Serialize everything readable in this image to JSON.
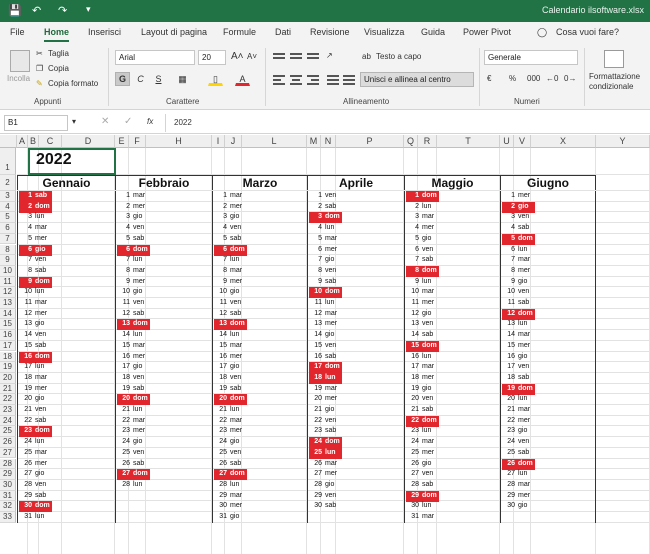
{
  "window": {
    "title": "Calendario ilsoftware.xlsx"
  },
  "tabs": [
    "File",
    "Home",
    "Inserisci",
    "Layout di pagina",
    "Formule",
    "Dati",
    "Revisione",
    "Visualizza",
    "Guida",
    "Power Pivot"
  ],
  "active_tab": "Home",
  "tell_me": "Cosa vuoi fare?",
  "clipboard": {
    "paste": "Incolla",
    "cut": "Taglia",
    "copy": "Copia",
    "format_painter": "Copia formato",
    "group": "Appunti"
  },
  "font": {
    "name": "Arial",
    "size": "20",
    "bold": "G",
    "italic": "C",
    "underline": "S",
    "group": "Carattere"
  },
  "alignment": {
    "wrap": "Testo a capo",
    "merge": "Unisci e allinea al centro",
    "group": "Allineamento"
  },
  "number": {
    "format": "Generale",
    "group": "Numeri",
    "percent": "%",
    "thousands": "000"
  },
  "styles": {
    "conditional": "Formattazione condizionale"
  },
  "formula_bar": {
    "name_box": "B1",
    "value": "2022",
    "fx": "fx"
  },
  "columns": [
    "A",
    "B",
    "C",
    "D",
    "E",
    "F",
    "G",
    "H",
    "I",
    "J",
    "K",
    "L",
    "M",
    "N",
    "O",
    "P",
    "Q",
    "R",
    "S",
    "T",
    "U",
    "V",
    "W",
    "X",
    "Y"
  ],
  "rows": [
    "1",
    "2",
    "3",
    "4",
    "5",
    "6",
    "7",
    "8",
    "9",
    "10",
    "11",
    "12",
    "13",
    "14",
    "15",
    "16",
    "17",
    "18",
    "19",
    "20",
    "21",
    "22",
    "23",
    "24",
    "25",
    "26",
    "27",
    "28",
    "29",
    "30",
    "31",
    "32",
    "33"
  ],
  "year": "2022",
  "holiday_color": "#e1262d",
  "months": [
    {
      "name": "Gennaio",
      "days": [
        [
          "1",
          "sab",
          1
        ],
        [
          "2",
          "dom",
          1
        ],
        [
          "3",
          "lun",
          0
        ],
        [
          "4",
          "mar",
          0
        ],
        [
          "5",
          "mer",
          0
        ],
        [
          "6",
          "gio",
          1
        ],
        [
          "7",
          "ven",
          0
        ],
        [
          "8",
          "sab",
          0
        ],
        [
          "9",
          "dom",
          1
        ],
        [
          "10",
          "lun",
          0
        ],
        [
          "11",
          "mar",
          0
        ],
        [
          "12",
          "mer",
          0
        ],
        [
          "13",
          "gio",
          0
        ],
        [
          "14",
          "ven",
          0
        ],
        [
          "15",
          "sab",
          0
        ],
        [
          "16",
          "dom",
          1
        ],
        [
          "17",
          "lun",
          0
        ],
        [
          "18",
          "mar",
          0
        ],
        [
          "19",
          "mer",
          0
        ],
        [
          "20",
          "gio",
          0
        ],
        [
          "21",
          "ven",
          0
        ],
        [
          "22",
          "sab",
          0
        ],
        [
          "23",
          "dom",
          1
        ],
        [
          "24",
          "lun",
          0
        ],
        [
          "25",
          "mar",
          0
        ],
        [
          "26",
          "mer",
          0
        ],
        [
          "27",
          "gio",
          0
        ],
        [
          "28",
          "ven",
          0
        ],
        [
          "29",
          "sab",
          0
        ],
        [
          "30",
          "dom",
          1
        ],
        [
          "31",
          "lun",
          0
        ]
      ]
    },
    {
      "name": "Febbraio",
      "days": [
        [
          "1",
          "mar",
          0
        ],
        [
          "2",
          "mer",
          0
        ],
        [
          "3",
          "gio",
          0
        ],
        [
          "4",
          "ven",
          0
        ],
        [
          "5",
          "sab",
          0
        ],
        [
          "6",
          "dom",
          1
        ],
        [
          "7",
          "lun",
          0
        ],
        [
          "8",
          "mar",
          0
        ],
        [
          "9",
          "mer",
          0
        ],
        [
          "10",
          "gio",
          0
        ],
        [
          "11",
          "ven",
          0
        ],
        [
          "12",
          "sab",
          0
        ],
        [
          "13",
          "dom",
          1
        ],
        [
          "14",
          "lun",
          0
        ],
        [
          "15",
          "mar",
          0
        ],
        [
          "16",
          "mer",
          0
        ],
        [
          "17",
          "gio",
          0
        ],
        [
          "18",
          "ven",
          0
        ],
        [
          "19",
          "sab",
          0
        ],
        [
          "20",
          "dom",
          1
        ],
        [
          "21",
          "lun",
          0
        ],
        [
          "22",
          "mar",
          0
        ],
        [
          "23",
          "mer",
          0
        ],
        [
          "24",
          "gio",
          0
        ],
        [
          "25",
          "ven",
          0
        ],
        [
          "26",
          "sab",
          0
        ],
        [
          "27",
          "dom",
          1
        ],
        [
          "28",
          "lun",
          0
        ]
      ]
    },
    {
      "name": "Marzo",
      "days": [
        [
          "1",
          "mar",
          0
        ],
        [
          "2",
          "mer",
          0
        ],
        [
          "3",
          "gio",
          0
        ],
        [
          "4",
          "ven",
          0
        ],
        [
          "5",
          "sab",
          0
        ],
        [
          "6",
          "dom",
          1
        ],
        [
          "7",
          "lun",
          0
        ],
        [
          "8",
          "mar",
          0
        ],
        [
          "9",
          "mer",
          0
        ],
        [
          "10",
          "gio",
          0
        ],
        [
          "11",
          "ven",
          0
        ],
        [
          "12",
          "sab",
          0
        ],
        [
          "13",
          "dom",
          1
        ],
        [
          "14",
          "lun",
          0
        ],
        [
          "15",
          "mar",
          0
        ],
        [
          "16",
          "mer",
          0
        ],
        [
          "17",
          "gio",
          0
        ],
        [
          "18",
          "ven",
          0
        ],
        [
          "19",
          "sab",
          0
        ],
        [
          "20",
          "dom",
          1
        ],
        [
          "21",
          "lun",
          0
        ],
        [
          "22",
          "mar",
          0
        ],
        [
          "23",
          "mer",
          0
        ],
        [
          "24",
          "gio",
          0
        ],
        [
          "25",
          "ven",
          0
        ],
        [
          "26",
          "sab",
          0
        ],
        [
          "27",
          "dom",
          1
        ],
        [
          "28",
          "lun",
          0
        ],
        [
          "29",
          "mar",
          0
        ],
        [
          "30",
          "mer",
          0
        ],
        [
          "31",
          "gio",
          0
        ]
      ]
    },
    {
      "name": "Aprile",
      "days": [
        [
          "1",
          "ven",
          0
        ],
        [
          "2",
          "sab",
          0
        ],
        [
          "3",
          "dom",
          1
        ],
        [
          "4",
          "lun",
          0
        ],
        [
          "5",
          "mar",
          0
        ],
        [
          "6",
          "mer",
          0
        ],
        [
          "7",
          "gio",
          0
        ],
        [
          "8",
          "ven",
          0
        ],
        [
          "9",
          "sab",
          0
        ],
        [
          "10",
          "dom",
          1
        ],
        [
          "11",
          "lun",
          0
        ],
        [
          "12",
          "mar",
          0
        ],
        [
          "13",
          "mer",
          0
        ],
        [
          "14",
          "gio",
          0
        ],
        [
          "15",
          "ven",
          0
        ],
        [
          "16",
          "sab",
          0
        ],
        [
          "17",
          "dom",
          1
        ],
        [
          "18",
          "lun",
          1
        ],
        [
          "19",
          "mar",
          0
        ],
        [
          "20",
          "mer",
          0
        ],
        [
          "21",
          "gio",
          0
        ],
        [
          "22",
          "ven",
          0
        ],
        [
          "23",
          "sab",
          0
        ],
        [
          "24",
          "dom",
          1
        ],
        [
          "25",
          "lun",
          1
        ],
        [
          "26",
          "mar",
          0
        ],
        [
          "27",
          "mer",
          0
        ],
        [
          "28",
          "gio",
          0
        ],
        [
          "29",
          "ven",
          0
        ],
        [
          "30",
          "sab",
          0
        ]
      ]
    },
    {
      "name": "Maggio",
      "days": [
        [
          "1",
          "dom",
          1
        ],
        [
          "2",
          "lun",
          0
        ],
        [
          "3",
          "mar",
          0
        ],
        [
          "4",
          "mer",
          0
        ],
        [
          "5",
          "gio",
          0
        ],
        [
          "6",
          "ven",
          0
        ],
        [
          "7",
          "sab",
          0
        ],
        [
          "8",
          "dom",
          1
        ],
        [
          "9",
          "lun",
          0
        ],
        [
          "10",
          "mar",
          0
        ],
        [
          "11",
          "mer",
          0
        ],
        [
          "12",
          "gio",
          0
        ],
        [
          "13",
          "ven",
          0
        ],
        [
          "14",
          "sab",
          0
        ],
        [
          "15",
          "dom",
          1
        ],
        [
          "16",
          "lun",
          0
        ],
        [
          "17",
          "mar",
          0
        ],
        [
          "18",
          "mer",
          0
        ],
        [
          "19",
          "gio",
          0
        ],
        [
          "20",
          "ven",
          0
        ],
        [
          "21",
          "sab",
          0
        ],
        [
          "22",
          "dom",
          1
        ],
        [
          "23",
          "lun",
          0
        ],
        [
          "24",
          "mar",
          0
        ],
        [
          "25",
          "mer",
          0
        ],
        [
          "26",
          "gio",
          0
        ],
        [
          "27",
          "ven",
          0
        ],
        [
          "28",
          "sab",
          0
        ],
        [
          "29",
          "dom",
          1
        ],
        [
          "30",
          "lun",
          0
        ],
        [
          "31",
          "mar",
          0
        ]
      ]
    },
    {
      "name": "Giugno",
      "days": [
        [
          "1",
          "mer",
          0
        ],
        [
          "2",
          "gio",
          1
        ],
        [
          "3",
          "ven",
          0
        ],
        [
          "4",
          "sab",
          0
        ],
        [
          "5",
          "dom",
          1
        ],
        [
          "6",
          "lun",
          0
        ],
        [
          "7",
          "mar",
          0
        ],
        [
          "8",
          "mer",
          0
        ],
        [
          "9",
          "gio",
          0
        ],
        [
          "10",
          "ven",
          0
        ],
        [
          "11",
          "sab",
          0
        ],
        [
          "12",
          "dom",
          1
        ],
        [
          "13",
          "lun",
          0
        ],
        [
          "14",
          "mar",
          0
        ],
        [
          "15",
          "mer",
          0
        ],
        [
          "16",
          "gio",
          0
        ],
        [
          "17",
          "ven",
          0
        ],
        [
          "18",
          "sab",
          0
        ],
        [
          "19",
          "dom",
          1
        ],
        [
          "20",
          "lun",
          0
        ],
        [
          "21",
          "mar",
          0
        ],
        [
          "22",
          "mer",
          0
        ],
        [
          "23",
          "gio",
          0
        ],
        [
          "24",
          "ven",
          0
        ],
        [
          "25",
          "sab",
          0
        ],
        [
          "26",
          "dom",
          1
        ],
        [
          "27",
          "lun",
          0
        ],
        [
          "28",
          "mar",
          0
        ],
        [
          "29",
          "mer",
          0
        ],
        [
          "30",
          "gio",
          0
        ]
      ]
    }
  ]
}
